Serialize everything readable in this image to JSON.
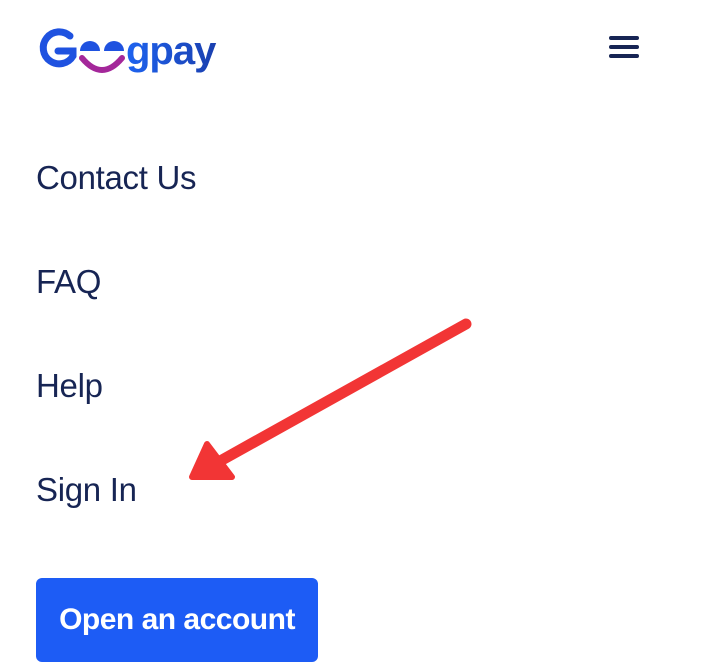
{
  "brand": {
    "logo_text": "Geegpay",
    "primary_color": "#1d5cf5",
    "logo_blue": "#1f4fd8",
    "logo_smile_color": "#a4279a",
    "text_color": "#172554"
  },
  "header": {
    "menu_icon": "hamburger-menu-icon"
  },
  "nav": {
    "items": [
      {
        "label": "Contact Us"
      },
      {
        "label": "FAQ"
      },
      {
        "label": "Help"
      },
      {
        "label": "Sign In"
      }
    ]
  },
  "cta": {
    "open_account_label": "Open an account"
  },
  "annotation": {
    "arrow_color": "#f23535",
    "arrow_target": "Sign In"
  }
}
